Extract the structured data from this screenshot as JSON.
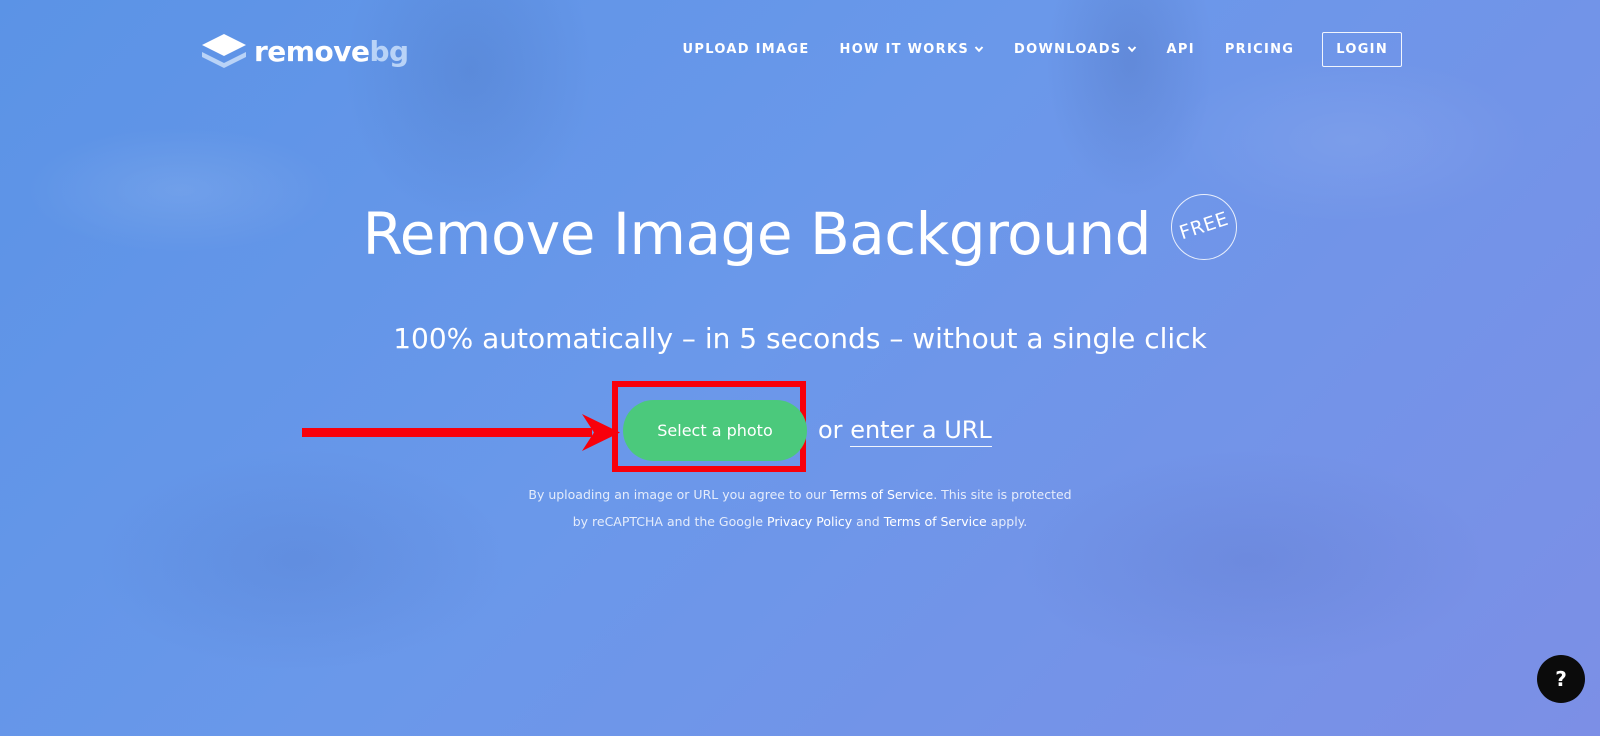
{
  "header": {
    "logo": {
      "word1": "remove",
      "word2": "bg"
    },
    "nav": [
      {
        "label": "UPLOAD IMAGE",
        "has_dropdown": false
      },
      {
        "label": "HOW IT WORKS",
        "has_dropdown": true
      },
      {
        "label": "DOWNLOADS",
        "has_dropdown": true
      },
      {
        "label": "API",
        "has_dropdown": false
      },
      {
        "label": "PRICING",
        "has_dropdown": false
      }
    ],
    "login_label": "LOGIN"
  },
  "hero": {
    "title": "Remove Image Background",
    "badge": "FREE",
    "subtitle": "100% automatically – in 5 seconds – without a single click"
  },
  "cta": {
    "select_label": "Select a photo",
    "or_text": "or",
    "url_link": "enter a URL"
  },
  "terms": {
    "line1_prefix": "By uploading an image or URL you agree to our",
    "line1_link": "Terms of Service",
    "line1_suffix": ". This site is protected",
    "line2_prefix": "by reCAPTCHA and the Google",
    "line2_link1": "Privacy Policy",
    "line2_and": "and",
    "line2_link2": "Terms of Service",
    "line2_suffix": "apply."
  },
  "help": {
    "label": "?"
  },
  "colors": {
    "background": "#6a98ea",
    "button_green": "#4bc97c",
    "highlight_red": "#f8000b",
    "help_black": "#0b0b0b"
  },
  "icons": [
    "layers-icon",
    "chevron-down-icon",
    "red-arrow-annotation"
  ]
}
